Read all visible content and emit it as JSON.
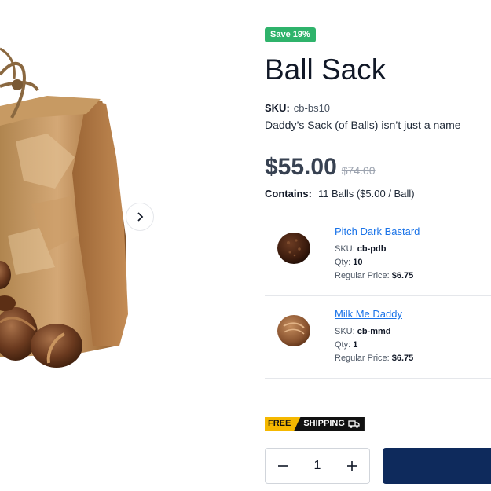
{
  "product": {
    "save_badge": "Save 19%",
    "title": "Ball Sack",
    "sku_label": "SKU:",
    "sku": "cb-bs10",
    "description": "Daddy’s Sack (of Balls) isn’t just a name—",
    "price": "$55.00",
    "old_price": "$74.00",
    "contains_label": "Contains:",
    "contains_value": "11 Balls ($5.00 / Ball)"
  },
  "bundle_items": [
    {
      "name": "Pitch Dark Bastard",
      "sku_label": "SKU:",
      "sku": "cb-pdb",
      "qty_label": "Qty:",
      "qty": "10",
      "price_label": "Regular Price:",
      "price": "$6.75"
    },
    {
      "name": "Milk Me Daddy",
      "sku_label": "SKU:",
      "sku": "cb-mmd",
      "qty_label": "Qty:",
      "qty": "1",
      "price_label": "Regular Price:",
      "price": "$6.75"
    }
  ],
  "shipping": {
    "free": "FREE",
    "shipping": "SHIPPING"
  },
  "quantity": {
    "value": "1"
  },
  "icons": {
    "next": "chevron-right-icon",
    "minus": "minus-icon",
    "plus": "plus-icon",
    "truck": "truck-icon"
  },
  "colors": {
    "save_badge": "#2fb36b",
    "link": "#1a73e8",
    "add_button": "#0e2a5c",
    "free_tag": "#f5b800"
  }
}
